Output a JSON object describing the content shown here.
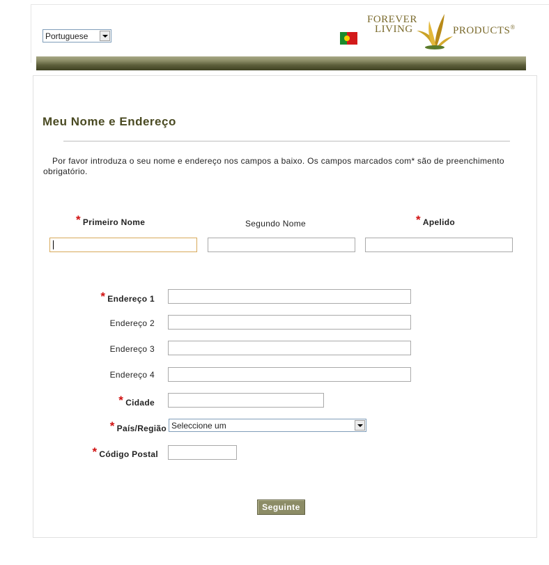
{
  "language": {
    "selected": "Portuguese"
  },
  "logo": {
    "line1": "FOREVER",
    "line2": "LIVING",
    "line3": "PRODUCTS",
    "reg_mark": "®"
  },
  "page": {
    "title": "Meu Nome e Endereço",
    "intro": "Por favor introduza o seu nome e endereço nos campos a baixo. Os campos marcados com* são de preenchimento obrigatório."
  },
  "form": {
    "required_marker": "*",
    "first_name_label": "Primeiro Nome",
    "middle_name_label": "Segundo Nome",
    "last_name_label": "Apelido",
    "address1_label": "Endereço 1",
    "address2_label": "Endereço 2",
    "address3_label": "Endereço 3",
    "address4_label": "Endereço 4",
    "city_label": "Cidade",
    "country_label": "País/Região",
    "country_selected": "Seleccione um",
    "postal_label": "Código Postal",
    "next_label": "Seguinte"
  },
  "colors": {
    "title": "#4a4a22",
    "band_dark": "#3f4122",
    "band_light": "#a7a886",
    "required_star": "#d01010",
    "button_bg": "#8c8c66",
    "focus_border": "#d7a95a"
  }
}
